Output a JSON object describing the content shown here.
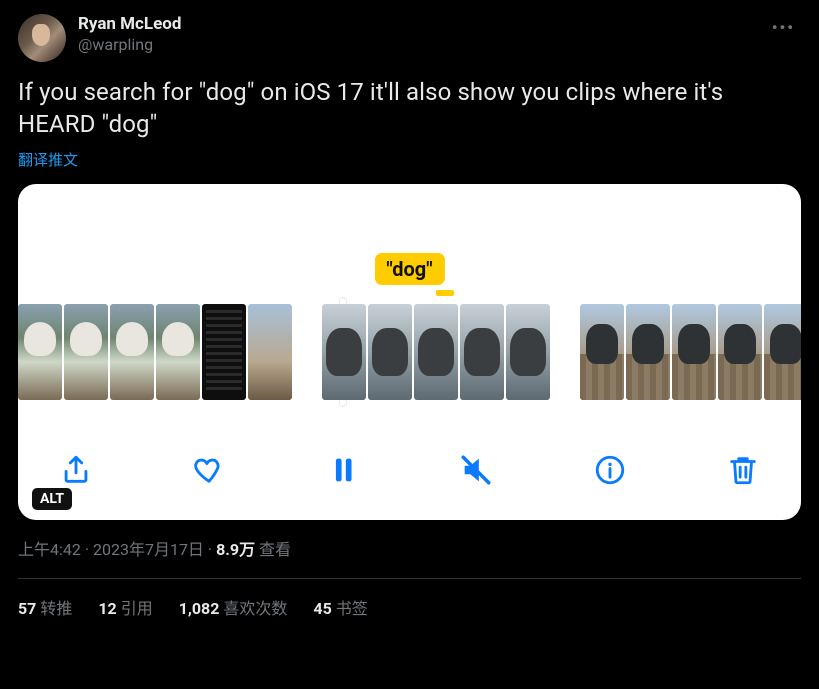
{
  "author": {
    "display_name": "Ryan McLeod",
    "handle": "@warpling"
  },
  "tweet_text": "If you search for \"dog\" on iOS 17 it'll also show you clips where it's HEARD \"dog\"",
  "translate_label": "翻译推文",
  "media": {
    "badge_text": "\"dog\"",
    "alt_label": "ALT"
  },
  "meta": {
    "time": "上午4:42",
    "date": "2023年7月17日",
    "views_count": "8.9万",
    "views_label": "查看",
    "separator": " · "
  },
  "stats": {
    "retweets": {
      "count": "57",
      "label": "转推"
    },
    "quotes": {
      "count": "12",
      "label": "引用"
    },
    "likes": {
      "count": "1,082",
      "label": "喜欢次数"
    },
    "bookmarks": {
      "count": "45",
      "label": "书签"
    }
  }
}
